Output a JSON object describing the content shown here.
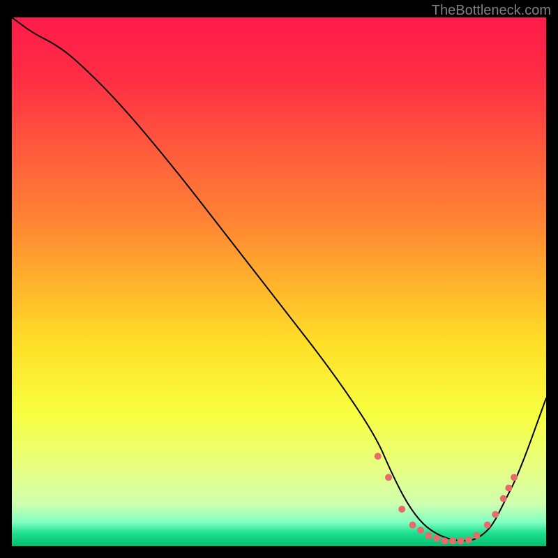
{
  "attribution": "TheBottleneck.com",
  "chart_data": {
    "type": "line",
    "title": "",
    "xlabel": "",
    "ylabel": "",
    "xlim": [
      0,
      100
    ],
    "ylim": [
      0,
      100
    ],
    "grid": false,
    "legend": false,
    "background_gradient": {
      "stops": [
        {
          "pos": 0.0,
          "color": "#ff1a4a"
        },
        {
          "pos": 0.12,
          "color": "#ff2f44"
        },
        {
          "pos": 0.25,
          "color": "#ff5a3c"
        },
        {
          "pos": 0.38,
          "color": "#ff8234"
        },
        {
          "pos": 0.5,
          "color": "#ffb22c"
        },
        {
          "pos": 0.62,
          "color": "#ffe028"
        },
        {
          "pos": 0.75,
          "color": "#f8ff40"
        },
        {
          "pos": 0.85,
          "color": "#e8ff80"
        },
        {
          "pos": 0.92,
          "color": "#d0ffb0"
        },
        {
          "pos": 0.955,
          "color": "#80ffc0"
        },
        {
          "pos": 0.975,
          "color": "#20e090"
        },
        {
          "pos": 1.0,
          "color": "#00c070"
        }
      ]
    },
    "series": [
      {
        "name": "curve",
        "stroke": "#000000",
        "stroke_width": 2,
        "x": [
          0,
          4,
          8,
          12,
          20,
          30,
          40,
          50,
          60,
          68,
          71,
          74,
          77,
          80,
          83,
          86,
          88,
          90,
          92,
          95,
          100
        ],
        "y": [
          100,
          97,
          95,
          92,
          84,
          72,
          59,
          46,
          33,
          21,
          14,
          8,
          4,
          2,
          1,
          1,
          2,
          4,
          8,
          14,
          28
        ]
      }
    ],
    "markers": {
      "name": "dots",
      "color": "#e86a6a",
      "radius": 5,
      "x": [
        68.5,
        70.5,
        73,
        75,
        76.5,
        78,
        79.5,
        81,
        82.5,
        84,
        85.5,
        87,
        89,
        90.5,
        92,
        93,
        94
      ],
      "y": [
        17,
        13,
        7,
        4,
        3,
        2,
        1.5,
        1,
        1,
        1,
        1.2,
        2,
        4,
        6,
        9,
        11,
        13
      ]
    }
  }
}
